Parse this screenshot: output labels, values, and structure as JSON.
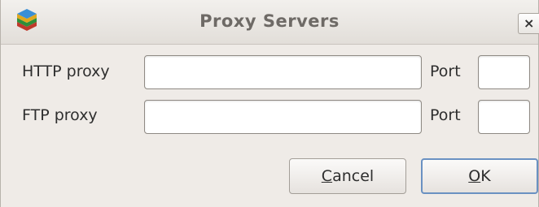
{
  "window": {
    "title": "Proxy Servers",
    "app_icon": "stacked-layers-icon",
    "close_glyph": "×"
  },
  "form": {
    "http_label": "HTTP proxy",
    "http_value": "",
    "http_port_label": "Port",
    "http_port_value": "",
    "ftp_label": "FTP proxy",
    "ftp_value": "",
    "ftp_port_label": "Port",
    "ftp_port_value": ""
  },
  "buttons": {
    "cancel_mnemonic": "C",
    "cancel_rest": "ancel",
    "ok_mnemonic": "O",
    "ok_rest": "K"
  },
  "colors": {
    "default_button_border": "#6a91c2",
    "window_background": "#efebe7"
  }
}
